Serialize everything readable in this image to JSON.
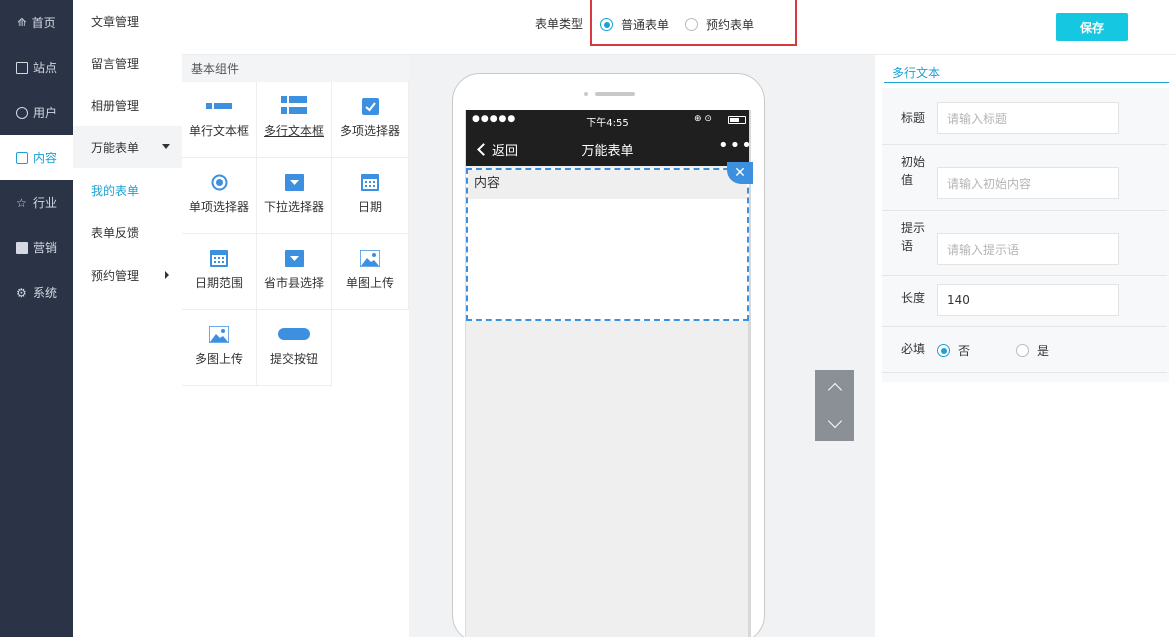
{
  "nav": {
    "items": [
      {
        "label": "首页",
        "icon": "home-icon"
      },
      {
        "label": "站点",
        "icon": "monitor-icon"
      },
      {
        "label": "用户",
        "icon": "user-icon"
      },
      {
        "label": "内容",
        "icon": "inbox-icon"
      },
      {
        "label": "行业",
        "icon": "star-icon"
      },
      {
        "label": "营销",
        "icon": "shop-icon"
      },
      {
        "label": "系统",
        "icon": "gear-icon"
      }
    ],
    "active_index": 3
  },
  "submenu": {
    "items": [
      {
        "label": "文章管理"
      },
      {
        "label": "留言管理"
      },
      {
        "label": "相册管理"
      },
      {
        "label": "万能表单"
      },
      {
        "label": "我的表单"
      },
      {
        "label": "表单反馈"
      },
      {
        "label": "预约管理"
      }
    ]
  },
  "topbar": {
    "form_type_label": "表单类型",
    "option_normal": "普通表单",
    "option_booking": "预约表单",
    "selected": "普通表单",
    "save_label": "保存"
  },
  "components": {
    "header": "基本组件",
    "items": [
      {
        "label": "单行文本框",
        "icon": "single-line-icon"
      },
      {
        "label": "多行文本框",
        "icon": "multi-line-icon"
      },
      {
        "label": "多项选择器",
        "icon": "checkbox-icon"
      },
      {
        "label": "单项选择器",
        "icon": "radio-icon"
      },
      {
        "label": "下拉选择器",
        "icon": "dropdown-icon"
      },
      {
        "label": "日期",
        "icon": "calendar-icon"
      },
      {
        "label": "日期范围",
        "icon": "calendar-range-icon"
      },
      {
        "label": "省市县选择",
        "icon": "region-dropdown-icon"
      },
      {
        "label": "单图上传",
        "icon": "image-icon"
      },
      {
        "label": "多图上传",
        "icon": "images-icon"
      },
      {
        "label": "提交按钮",
        "icon": "submit-button-icon"
      }
    ],
    "highlighted": "多行文本框"
  },
  "phone": {
    "signal": "●●●●●",
    "time": "下午4:55",
    "back_label": "返回",
    "title": "万能表单",
    "more": "•••",
    "field_label": "内容",
    "close_glyph": "✕"
  },
  "properties": {
    "tab": "多行文本",
    "rows": {
      "title_label": "标题",
      "title_placeholder": "请输入标题",
      "initial_label": "初始值",
      "initial_placeholder": "请输入初始内容",
      "hint_label": "提示语",
      "hint_placeholder": "请输入提示语",
      "length_label": "长度",
      "length_value": "140",
      "required_label": "必填",
      "required_no": "否",
      "required_yes": "是",
      "required_selected": "否"
    }
  },
  "colors": {
    "accent": "#1aa1d6",
    "nav_bg": "#2b3447",
    "save_bg": "#15c7e0",
    "highlight_border": "#d9383f",
    "component_icon": "#3d8fe0"
  }
}
